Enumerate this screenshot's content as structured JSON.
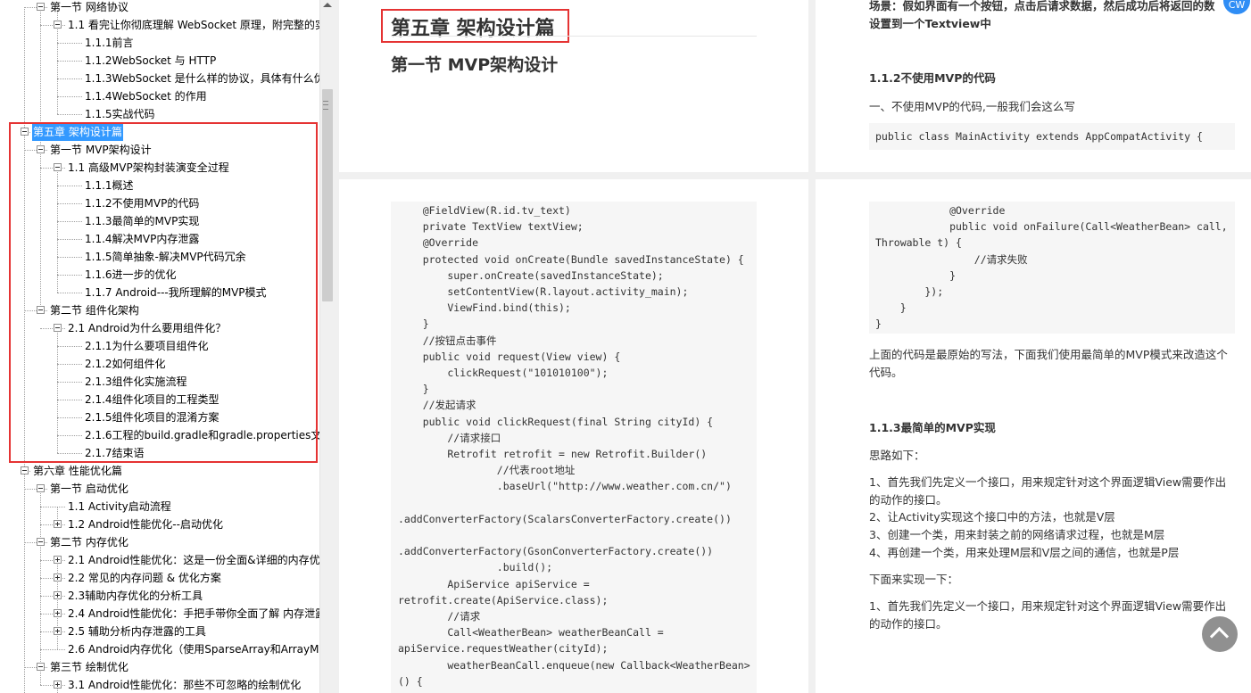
{
  "outline": {
    "items": [
      {
        "label": "第一节 网络协议"
      },
      {
        "label": "1.1 看完让你彻底理解 WebSocket 原理，附完整的实"
      },
      {
        "label": "1.1.1前言"
      },
      {
        "label": "1.1.2WebSocket 与 HTTP"
      },
      {
        "label": "1.1.3WebSocket 是什么样的协议，具体有什么优"
      },
      {
        "label": "1.1.4WebSocket 的作用"
      },
      {
        "label": "1.1.5实战代码"
      },
      {
        "label": "第五章 架构设计篇"
      },
      {
        "label": "第一节 MVP架构设计"
      },
      {
        "label": "1.1 高级MVP架构封装演变全过程"
      },
      {
        "label": "1.1.1概述"
      },
      {
        "label": "1.1.2不使用MVP的代码"
      },
      {
        "label": "1.1.3最简单的MVP实现"
      },
      {
        "label": "1.1.4解决MVP内存泄露"
      },
      {
        "label": "1.1.5简单抽象-解决MVP代码冗余"
      },
      {
        "label": "1.1.6进一步的优化"
      },
      {
        "label": "1.1.7 Android---我所理解的MVP模式"
      },
      {
        "label": "第二节 组件化架构"
      },
      {
        "label": "2.1 Android为什么要用组件化？"
      },
      {
        "label": "2.1.1为什么要项目组件化"
      },
      {
        "label": "2.1.2如何组件化"
      },
      {
        "label": "2.1.3组件化实施流程"
      },
      {
        "label": "2.1.4组件化项目的工程类型"
      },
      {
        "label": "2.1.5组件化项目的混淆方案"
      },
      {
        "label": "2.1.6工程的build.gradle和gradle.properties文"
      },
      {
        "label": "2.1.7结束语"
      },
      {
        "label": "第六章 性能优化篇"
      },
      {
        "label": "第一节 启动优化"
      },
      {
        "label": "1.1 Activity启动流程"
      },
      {
        "label": "1.2 Android性能优化--启动优化"
      },
      {
        "label": "第二节 内存优化"
      },
      {
        "label": "2.1 Android性能优化：这是一份全面&详细的内存优"
      },
      {
        "label": "2.2 常见的内存问题 & 优化方案"
      },
      {
        "label": "2.3辅助内存优化的分析工具"
      },
      {
        "label": "2.4 Android性能优化：手把手带你全面了解 内存泄露"
      },
      {
        "label": "2.5 辅助分析内存泄露的工具"
      },
      {
        "label": "2.6 Android内存优化（使用SparseArray和ArrayMa"
      },
      {
        "label": "第三节 绘制优化"
      },
      {
        "label": "3.1 Android性能优化：那些不可忽略的绘制优化"
      }
    ]
  },
  "page1": {
    "chapter_title": "第五章 架构设计篇",
    "section_title": "第一节 MVP架构设计"
  },
  "page2": {
    "scenario": [
      "场景：假如界面有一个按钮，点击后请求数据，然后成功后将返回的数",
      "设置到一个Textview中"
    ],
    "heading_112": "1.1.2不使用MVP的代码",
    "intro": "一、不使用MVP的代码,一般我们会这么写",
    "code_start": "public class MainActivity extends AppCompatActivity {"
  },
  "page3": {
    "code_lines": [
      "    @FieldView(R.id.tv_text)",
      "    private TextView textView;",
      "    @Override",
      "    protected void onCreate(Bundle savedInstanceState) {",
      "        super.onCreate(savedInstanceState);",
      "        setContentView(R.layout.activity_main);",
      "        ViewFind.bind(this);",
      "    }",
      "    //按钮点击事件",
      "    public void request(View view) {",
      "        clickRequest(\"101010100\");",
      "    }",
      "    //发起请求",
      "    public void clickRequest(final String cityId) {",
      "        //请求接口",
      "        Retrofit retrofit = new Retrofit.Builder()",
      "                //代表root地址",
      "                .baseUrl(\"http://www.weather.com.cn/\")",
      "",
      ".addConverterFactory(ScalarsConverterFactory.create())",
      "",
      ".addConverterFactory(GsonConverterFactory.create())",
      "                .build();",
      "        ApiService apiService =",
      "retrofit.create(ApiService.class);",
      "        //请求",
      "        Call<WeatherBean> weatherBeanCall =",
      "apiService.requestWeather(cityId);",
      "        weatherBeanCall.enqueue(new Callback<WeatherBean>",
      "() {"
    ]
  },
  "page4": {
    "code_lines": [
      "            @Override",
      "            public void onFailure(Call<WeatherBean> call,",
      "Throwable t) {",
      "                //请求失败",
      "            }",
      "        });",
      "    }",
      "}"
    ],
    "para1": [
      "上面的代码是最原始的写法，下面我们使用最简单的MVP模式来改造这个",
      "代码。"
    ],
    "heading_113": "1.1.3最简单的MVP实现",
    "thought": "思路如下：",
    "steps": [
      "1、首先我们先定义一个接口，用来规定针对这个界面逻辑View需要作出",
      "的动作的接口。",
      "2、让Activity实现这个接口中的方法，也就是V层",
      "3、创建一个类，用来封装之前的网络请求过程，也就是M层",
      "4、再创建一个类，用来处理M层和V层之间的通信，也就是P层"
    ],
    "implement": "下面来实现一下：",
    "step1": [
      "1、首先我们先定义一个接口，用来规定针对这个界面逻辑View需要作出",
      "的动作的接口。"
    ]
  },
  "floating": {
    "assistant_label": "CW"
  }
}
